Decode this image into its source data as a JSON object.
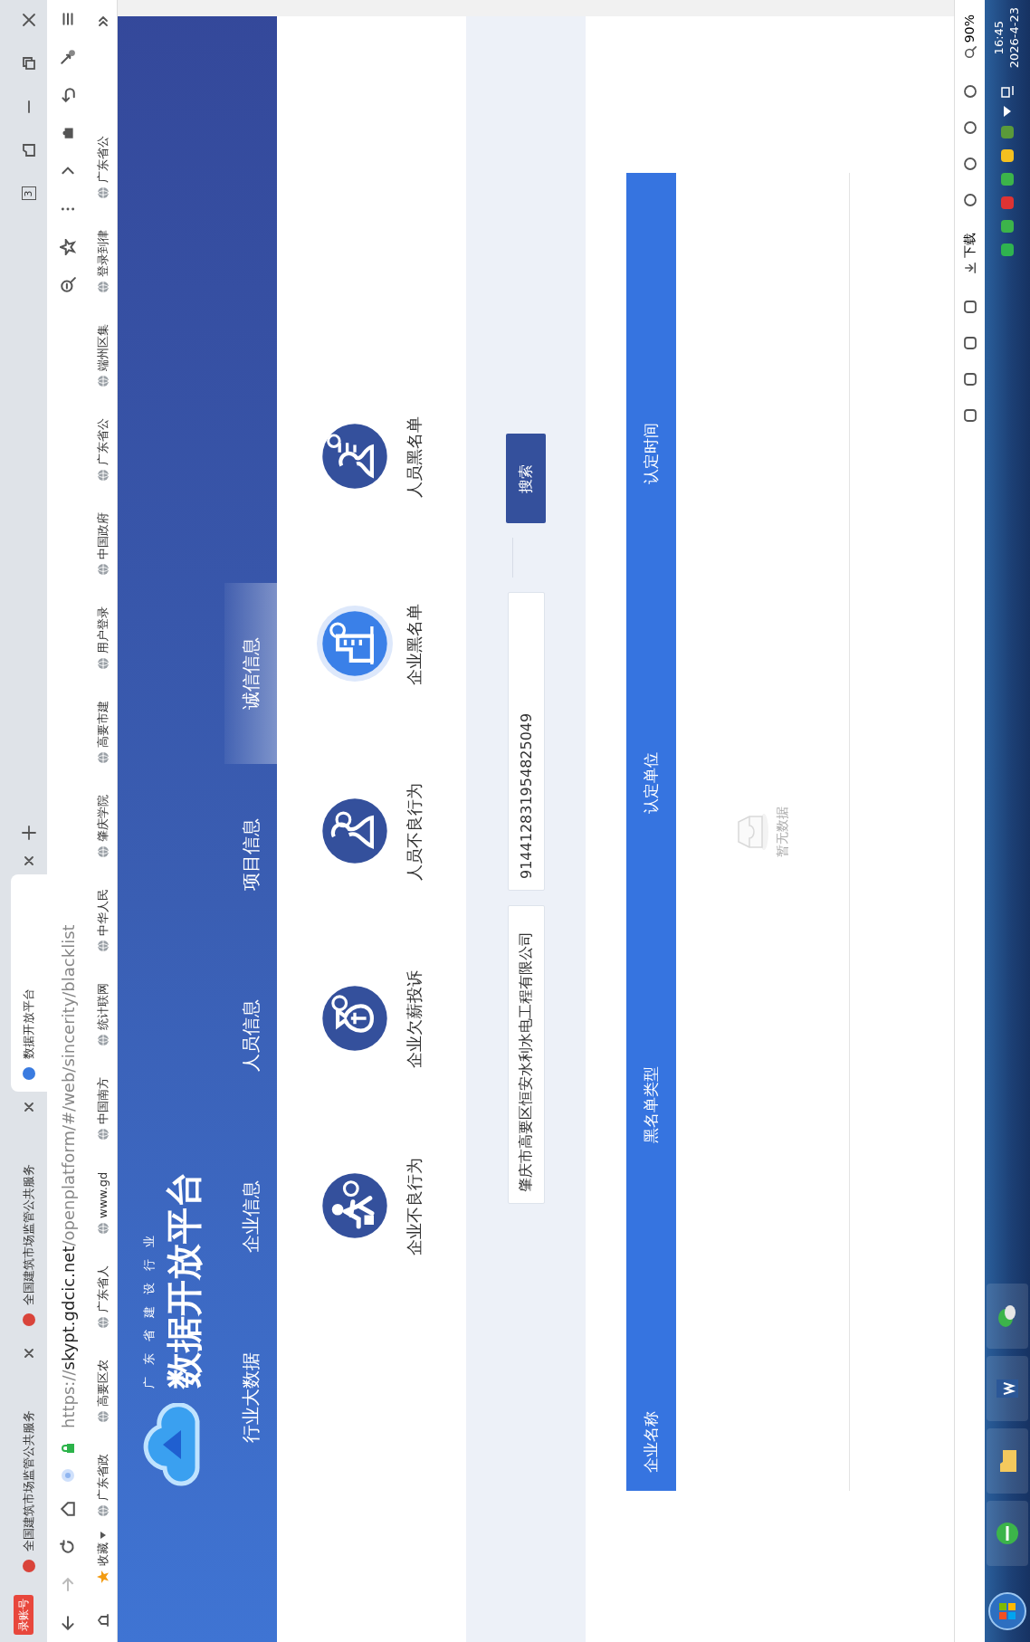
{
  "browser": {
    "account_badge": "录账号",
    "tabs": [
      {
        "label": "全国建筑市场监管公共服务",
        "selected": false
      },
      {
        "label": "全国建筑市场监管公共服务",
        "selected": false
      },
      {
        "label": "数据开放平台",
        "selected": true
      }
    ],
    "window_count": "3",
    "url": {
      "scheme": "https://",
      "host": "skypt.gdcic.net",
      "path": "/openplatform/#/web/sincerity/blacklist"
    },
    "favorites": "收藏",
    "bookmarks": [
      "广东省政",
      "高要区农",
      "广东省人",
      "www.gd",
      "中国南方",
      "统计联网",
      "中华人民",
      "肇庆学院",
      "高要市建",
      "用户登录",
      "中国政府",
      "广东省公",
      "端州区集",
      "登录到律",
      "广东省公"
    ]
  },
  "site": {
    "subtitle": "广东省建设行业",
    "title": "数据开放平台",
    "nav": [
      {
        "label": "行业大数据",
        "selected": false
      },
      {
        "label": "企业信息",
        "selected": false
      },
      {
        "label": "人员信息",
        "selected": false
      },
      {
        "label": "项目信息",
        "selected": false
      },
      {
        "label": "诚信信息",
        "selected": true
      }
    ]
  },
  "categories": [
    {
      "label": "企业不良行为",
      "selected": false
    },
    {
      "label": "企业欠薪投诉",
      "selected": false
    },
    {
      "label": "人员不良行为",
      "selected": false
    },
    {
      "label": "企业黑名单",
      "selected": true
    },
    {
      "label": "人员黑名单",
      "selected": false
    }
  ],
  "search": {
    "fields": [
      {
        "value": "肇庆市高要区恒安水利水电工程有限公司"
      },
      {
        "value": "914412831954825049"
      }
    ],
    "button": "搜索"
  },
  "table": {
    "columns": [
      "企业名称",
      "黑名单类型",
      "认定单位",
      "认定时间"
    ],
    "empty_text": "暂无数据"
  },
  "status_bar": {
    "download": "下载",
    "zoom": "90%"
  },
  "taskbar": {
    "time": "16:45",
    "date": "2026-4-23"
  }
}
